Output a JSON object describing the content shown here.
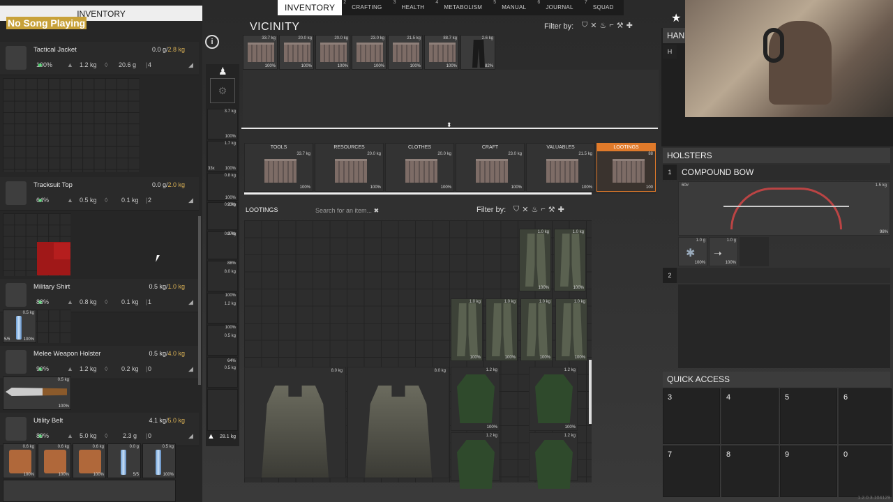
{
  "nav": {
    "tabs": [
      {
        "num": "",
        "label": "INVENTORY"
      },
      {
        "num": "2",
        "label": "CRAFTING"
      },
      {
        "num": "3",
        "label": "HEALTH"
      },
      {
        "num": "4",
        "label": "METABOLISM"
      },
      {
        "num": "5",
        "label": "MANUAL"
      },
      {
        "num": "6",
        "label": "JOURNAL"
      },
      {
        "num": "7",
        "label": "SQUAD"
      }
    ],
    "active": 0
  },
  "overlay": {
    "song": "No Song Playing"
  },
  "left": {
    "title": "INVENTORY",
    "items": [
      {
        "name": "Tactical Jacket",
        "wt_a": "0.0 g/",
        "wt_b": "2.8 kg",
        "cond": "100%",
        "weight": "1.2 kg",
        "water": "20.6 g",
        "count": "4"
      },
      {
        "name": "Tracksuit Top",
        "wt_a": "0.0 g/",
        "wt_b": "2.0 kg",
        "cond": "64%",
        "weight": "0.5 kg",
        "water": "0.1 kg",
        "count": "2"
      },
      {
        "name": "Military Shirt",
        "wt_a": "0.5 kg/",
        "wt_b": "1.0 kg",
        "cond": "88%",
        "weight": "0.8 kg",
        "water": "0.1 kg",
        "count": "1"
      },
      {
        "name": "Melee Weapon Holster",
        "wt_a": "0.5 kg/",
        "wt_b": "4.0 kg",
        "cond": "90%",
        "weight": "1.2 kg",
        "water": "0.2 kg",
        "count": "0"
      },
      {
        "name": "Utility Belt",
        "wt_a": "4.1 kg/",
        "wt_b": "5.0 kg",
        "cond": "89%",
        "weight": "5.0 kg",
        "water": "2.3 g",
        "count": "0"
      }
    ],
    "shirt_slot": {
      "w": "0.5 kg",
      "p": "100%",
      "q": "5/5"
    },
    "holster_slot": {
      "w": "0.5 kg",
      "p": "100%"
    },
    "belt_slots": [
      {
        "w": "0.6 kg",
        "p": "100%"
      },
      {
        "w": "0.6 kg",
        "p": "100%"
      },
      {
        "w": "0.6 kg",
        "p": "100%"
      },
      {
        "w": "0.0 g",
        "p": "5/5"
      },
      {
        "w": "0.5 kg",
        "p": "100%"
      }
    ]
  },
  "equip": {
    "weights": [
      "3.7 kg",
      "1.7 kg",
      "0.8 kg",
      "0.2 kg",
      "0.3 kg",
      "8.0 kg",
      "1.2 kg",
      "0.5 kg",
      "0.5 kg"
    ],
    "percents": [
      "100%",
      "100%",
      "100%",
      "93%",
      "87%",
      "88%",
      "100%",
      "100%",
      "64%"
    ],
    "ammo": "33x",
    "total": "28.1 kg"
  },
  "vicinity": {
    "title": "VICINITY",
    "filter_label": "Filter by:",
    "items": [
      {
        "w": "33.7 kg",
        "p": "100%"
      },
      {
        "w": "20.0 kg",
        "p": "100%"
      },
      {
        "w": "20.0 kg",
        "p": "100%"
      },
      {
        "w": "23.0 kg",
        "p": "100%"
      },
      {
        "w": "21.5 kg",
        "p": "100%"
      },
      {
        "w": "88.7 kg",
        "p": "100%"
      },
      {
        "w": "2.6 kg",
        "p": "82%"
      }
    ],
    "categories": [
      {
        "label": "TOOLS",
        "w": "33.7 kg",
        "p": "100%"
      },
      {
        "label": "RESOURCES",
        "w": "20.0 kg",
        "p": "100%"
      },
      {
        "label": "CLOTHES",
        "w": "20.0 kg",
        "p": "100%"
      },
      {
        "label": "CRAFT",
        "w": "23.0 kg",
        "p": "100%"
      },
      {
        "label": "VALUABLES",
        "w": "21.5 kg",
        "p": "100%"
      },
      {
        "label": "LOOTINGS",
        "w": "88",
        "p": "100"
      }
    ],
    "selected_category": 5,
    "loot": {
      "title": "LOOTINGS",
      "search_placeholder": "Search for an item...",
      "filter_label": "Filter by:",
      "pants": [
        {
          "w": "1.0 kg",
          "p": "100%"
        },
        {
          "w": "1.0 kg",
          "p": "100%"
        },
        {
          "w": "1.0 kg",
          "p": "100%"
        },
        {
          "w": "1.0 kg",
          "p": "100%"
        },
        {
          "w": "1.0 kg",
          "p": "100%"
        },
        {
          "w": "1.0 kg",
          "p": "100%"
        }
      ],
      "vests": [
        {
          "w": "8.0 kg"
        },
        {
          "w": "8.0 kg"
        }
      ],
      "jackets": [
        {
          "w": "1.2 kg",
          "p": "100%"
        },
        {
          "w": "1.2 kg",
          "p": "100%"
        },
        {
          "w": "1.2 kg",
          "p": ""
        },
        {
          "w": "1.2 kg",
          "p": ""
        }
      ]
    }
  },
  "right": {
    "hands_label": "HANI",
    "hands_key": "H",
    "holsters_title": "HOLSTERS",
    "slot1_num": "1",
    "slot1_name": "COMPOUND BOW",
    "bow_w1": "60#",
    "bow_w2": "1.5 kg",
    "bow_p": "98%",
    "attachments": [
      {
        "w": "1.0 g",
        "p": "100%"
      },
      {
        "w": "1.0 g",
        "p": "100%"
      }
    ],
    "slot2_num": "2",
    "qa_title": "QUICK ACCESS",
    "qa_keys": [
      "3",
      "4",
      "5",
      "6",
      "7",
      "8",
      "9",
      "0"
    ],
    "version": "1.2.0.3.104129"
  }
}
